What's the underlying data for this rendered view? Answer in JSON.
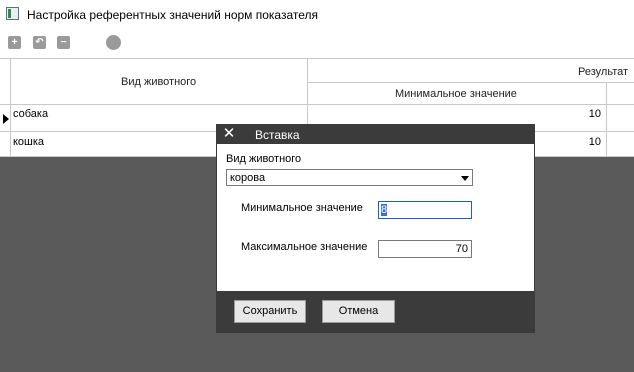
{
  "window": {
    "title": "Настройка референтных значений норм показателя"
  },
  "toolbar": {
    "add": "+",
    "edit": "↶",
    "remove": "−"
  },
  "grid": {
    "header_animal": "Вид животного",
    "header_result": "Результат",
    "header_min": "Минимальное значение",
    "rows": [
      {
        "animal": "собака",
        "min": "10"
      },
      {
        "animal": "кошка",
        "min": "10"
      }
    ]
  },
  "dialog": {
    "close": "✕",
    "title": "Вставка",
    "animal_label": "Вид животного",
    "animal_value": "корова",
    "min_label": "Минимальное значение",
    "min_value": "8",
    "max_label": "Максимальное значение",
    "max_value": "70",
    "save_label": "Сохранить",
    "cancel_label": "Отмена"
  },
  "colors": {
    "dialog_bg": "#3b3b3b",
    "focus_border": "#1e5cc8",
    "overlay": "#5a5a5a"
  }
}
